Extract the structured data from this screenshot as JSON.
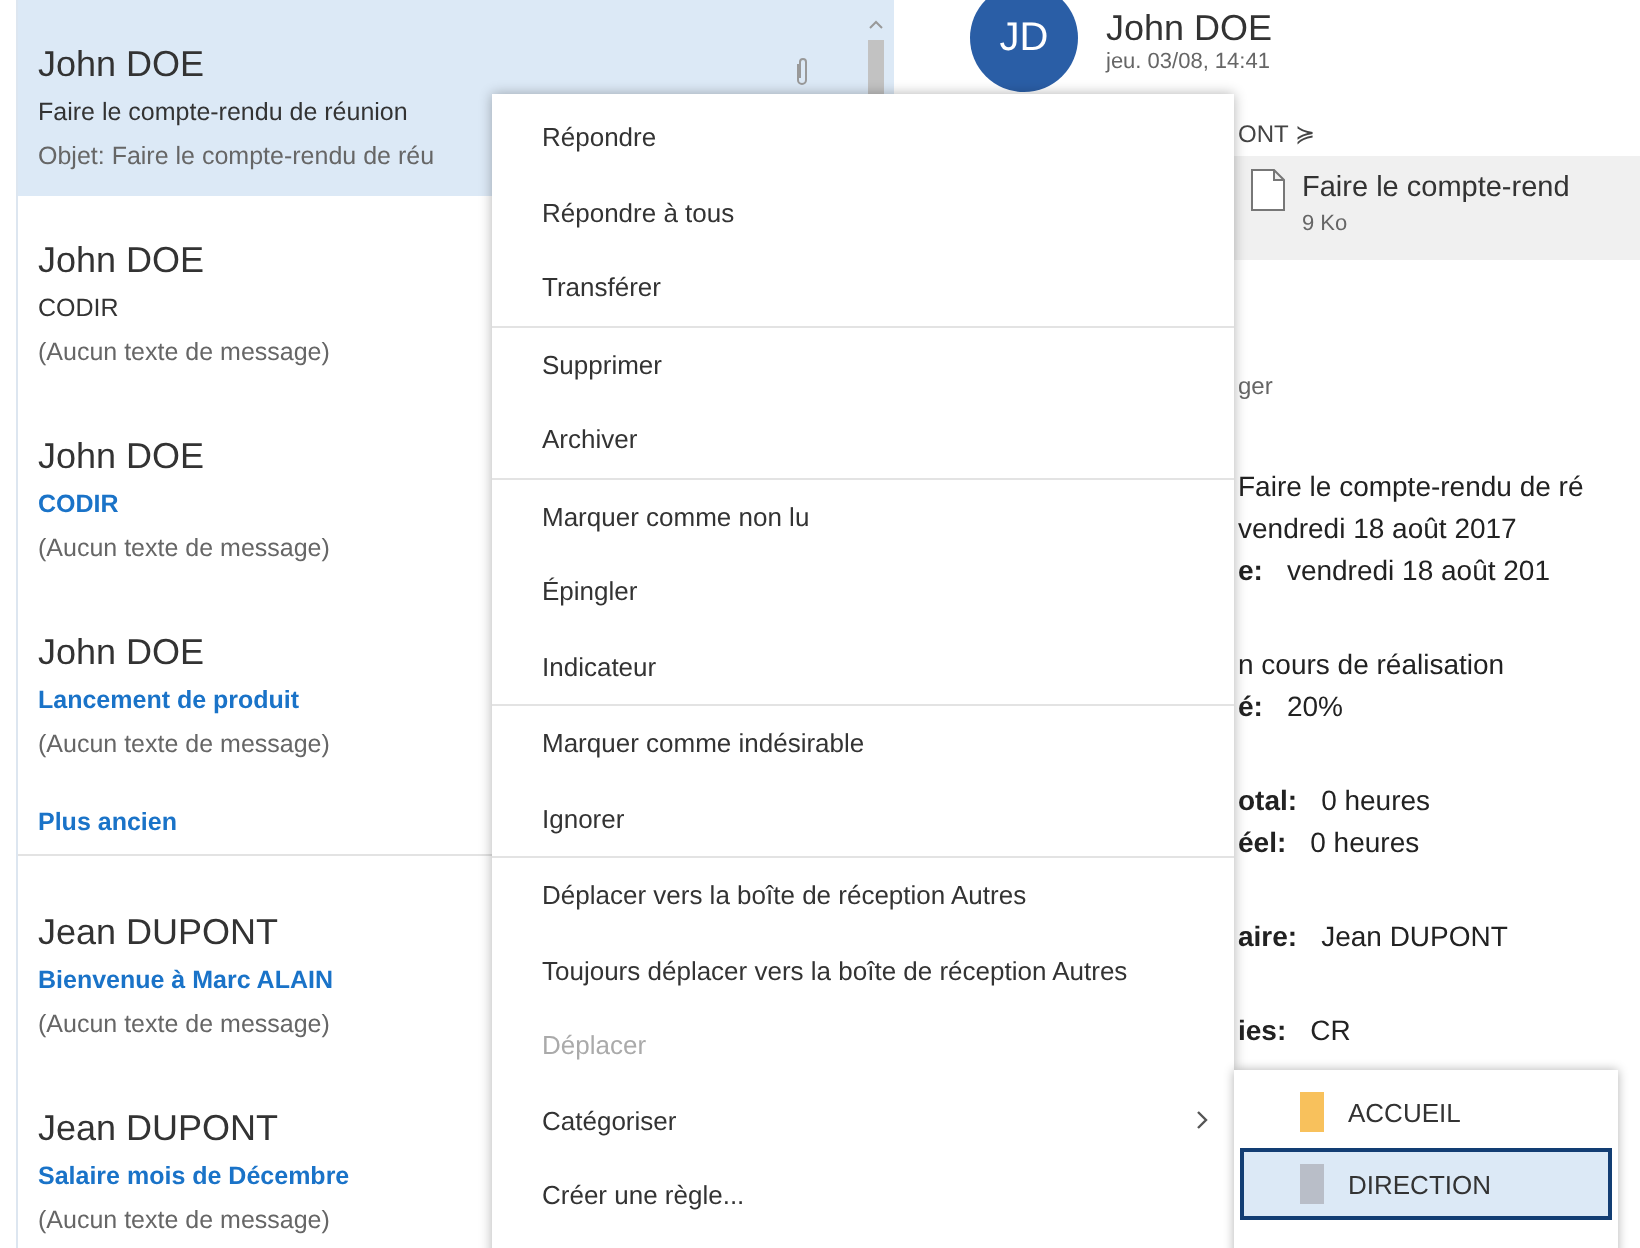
{
  "message_list": [
    {
      "kind": "message",
      "sender": "John DOE",
      "subject": "Faire le compte-rendu de réunion",
      "preview": "Objet: Faire le compte-rendu de réu",
      "selected": true,
      "unread": false,
      "attachment": true
    },
    {
      "kind": "message",
      "sender": "John DOE",
      "subject": "CODIR",
      "preview": "(Aucun texte de message)",
      "selected": false,
      "unread": false
    },
    {
      "kind": "message",
      "sender": "John DOE",
      "subject": "CODIR",
      "preview": "(Aucun texte de message)",
      "selected": false,
      "unread": true
    },
    {
      "kind": "message",
      "sender": "John DOE",
      "subject": "Lancement de produit",
      "preview": "(Aucun texte de message)",
      "selected": false,
      "unread": true
    },
    {
      "kind": "group",
      "label": "Plus ancien"
    },
    {
      "kind": "message",
      "sender": "Jean DUPONT",
      "subject": "Bienvenue à Marc ALAIN",
      "preview": "(Aucun texte de message)",
      "selected": false,
      "unread": true
    },
    {
      "kind": "message",
      "sender": "Jean DUPONT",
      "subject": "Salaire mois de Décembre",
      "preview": "(Aucun texte de message)",
      "selected": false,
      "unread": true
    }
  ],
  "reading_pane": {
    "avatar_initials": "JD",
    "sender": "John DOE",
    "date": "jeu. 03/08, 14:41",
    "recipients": "ONT ≽",
    "attachment": {
      "name": "Faire le compte-rend",
      "size": "9 Ko"
    },
    "attachment_action": "ger",
    "body": [
      [
        {
          "value": "Faire le compte-rendu de ré"
        },
        {
          "value": "vendredi 18 août 2017"
        },
        {
          "label": "e:",
          "value": "vendredi 18 août 201"
        }
      ],
      [
        {
          "value": "n cours de réalisation"
        },
        {
          "label": "é:",
          "value": "20%"
        }
      ],
      [
        {
          "label": "otal:",
          "value": "0 heures"
        },
        {
          "label": "éel:",
          "value": "0 heures"
        }
      ],
      [
        {
          "label": "aire:",
          "value": "Jean DUPONT"
        }
      ],
      [
        {
          "label": "ies:",
          "value": "CR"
        }
      ]
    ]
  },
  "context_menu": [
    [
      {
        "label": "Répondre",
        "disabled": false,
        "submenu": false
      },
      {
        "label": "Répondre à tous",
        "disabled": false,
        "submenu": false
      },
      {
        "label": "Transférer",
        "disabled": false,
        "submenu": false
      }
    ],
    [
      {
        "label": "Supprimer",
        "disabled": false,
        "submenu": false
      },
      {
        "label": "Archiver",
        "disabled": false,
        "submenu": false
      }
    ],
    [
      {
        "label": "Marquer comme non lu",
        "disabled": false,
        "submenu": false
      },
      {
        "label": "Épingler",
        "disabled": false,
        "submenu": false
      },
      {
        "label": "Indicateur",
        "disabled": false,
        "submenu": false
      }
    ],
    [
      {
        "label": "Marquer comme indésirable",
        "disabled": false,
        "submenu": false
      },
      {
        "label": "Ignorer",
        "disabled": false,
        "submenu": false
      }
    ],
    [
      {
        "label": "Déplacer vers la boîte de réception Autres",
        "disabled": false,
        "submenu": false
      },
      {
        "label": "Toujours déplacer vers la boîte de réception Autres",
        "disabled": false,
        "submenu": false
      },
      {
        "label": "Déplacer",
        "disabled": true,
        "submenu": false
      },
      {
        "label": "Catégoriser",
        "disabled": false,
        "submenu": true
      },
      {
        "label": "Créer une règle...",
        "disabled": false,
        "submenu": false
      }
    ]
  ],
  "category_submenu": [
    {
      "label": "ACCUEIL",
      "color": "#f8c15c",
      "selected": false
    },
    {
      "label": "DIRECTION",
      "color": "#b9bec8",
      "selected": true
    }
  ]
}
